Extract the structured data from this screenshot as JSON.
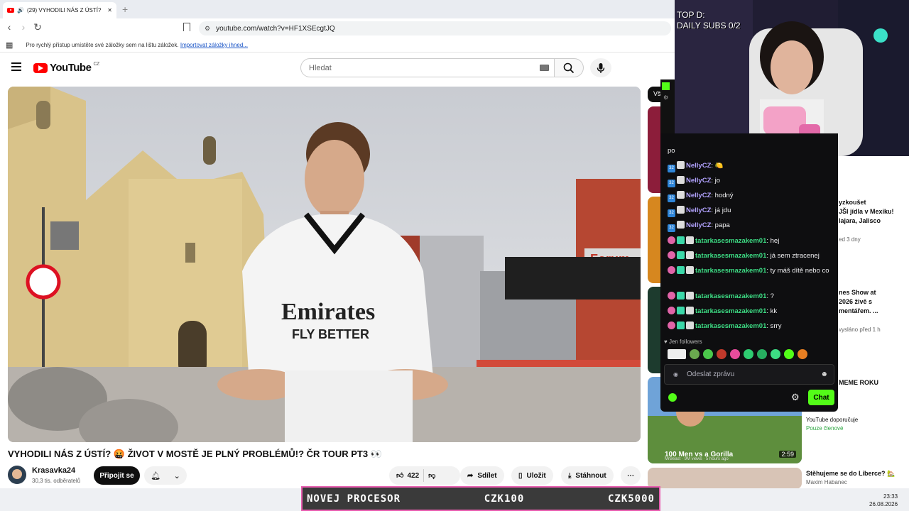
{
  "browser": {
    "tab_title": "(29) VYHODILI NÁS Z ÚSTÍ?",
    "url": "youtube.com/watch?v=HF1XSEcgtJQ",
    "bookmarks_hint": "Pro rychlý přístup umístěte své záložky sem na lištu záložek.",
    "bookmarks_link": "Importovat záložky ihned..."
  },
  "youtube": {
    "logo_text": "YouTube",
    "region": "CZ",
    "search_placeholder": "Hledat"
  },
  "video": {
    "title": "VYHODILI NÁS Z ÚSTÍ? 🤬 ŽIVOT V MOSTĚ JE PLNÝ PROBLÉMŮ!? ČR TOUR PT3 👀",
    "channel": "Krasavka24",
    "subscribers": "30,3 tis. odběratelů",
    "join_label": "Připojit se",
    "likes": "422",
    "share_label": "Sdílet",
    "save_label": "Uložit",
    "download_label": "Stáhnout",
    "shirt_brand": "Emirates",
    "shirt_slogan": "FLY BETTER",
    "sign_text": "Forum"
  },
  "recommendations": {
    "chip": "Vš",
    "items": [
      {
        "line1": "yzkoušet",
        "line2": "JŠI jídla v Mexiku!",
        "line3": "lajara, Jalisco",
        "meta": "ed 3 dny"
      },
      {
        "line1": "nes Show at",
        "line2": "2026 živě s",
        "line3": "mentářem. ...",
        "meta": "vysláno před 1 h"
      },
      {
        "line1": "MEME ROKU",
        "line2": "",
        "line3": "",
        "meta": ""
      },
      {
        "line1": "",
        "line2": "YouTube doporučuje",
        "line3": "Pouze členové",
        "meta": ""
      }
    ],
    "gorilla_title": "100 Men vs a Gorilla",
    "gorilla_duration": "2:59",
    "gorilla_meta": "MrBeast · 9M views · 5 hours ago",
    "last_title": "Stěhujeme se do Liberce? 🏡",
    "last_channel": "Maxim Habanec"
  },
  "stream": {
    "cam_line1": "TOP D:",
    "cam_line2": "DAILY SUBS 0/2",
    "chat_partial": "po",
    "messages": [
      {
        "user": "NellyCZ",
        "text": "🍋",
        "kind": "nelly"
      },
      {
        "user": "NellyCZ",
        "text": "jo",
        "kind": "nelly"
      },
      {
        "user": "NellyCZ",
        "text": "hodný",
        "kind": "nelly"
      },
      {
        "user": "NellyCZ",
        "text": "já jdu",
        "kind": "nelly"
      },
      {
        "user": "NellyCZ",
        "text": "papa",
        "kind": "nelly"
      },
      {
        "user": "tatarkasesmazakem01",
        "text": "hej",
        "kind": "tatar"
      },
      {
        "user": "tatarkasesmazakem01",
        "text": "já sem ztracenej",
        "kind": "tatar"
      },
      {
        "user": "tatarkasesmazakem01",
        "text": "ty máš dítě nebo co",
        "kind": "tatar"
      },
      {
        "user": "tatarkasesmazakem01",
        "text": "?",
        "kind": "tatar"
      },
      {
        "user": "tatarkasesmazakem01",
        "text": "kk",
        "kind": "tatar"
      },
      {
        "user": "tatarkasesmazakem01",
        "text": "srry",
        "kind": "tatar"
      }
    ],
    "followers_only": "Jen followers",
    "input_placeholder": "Odeslat zprávu",
    "chat_button": "Chat"
  },
  "ticker": {
    "item1": "NOVEJ PROCESOR",
    "item2": "CZK100",
    "item3": "CZK5000"
  },
  "taskbar": {
    "time": "23:33",
    "date": "26.08.2026"
  }
}
